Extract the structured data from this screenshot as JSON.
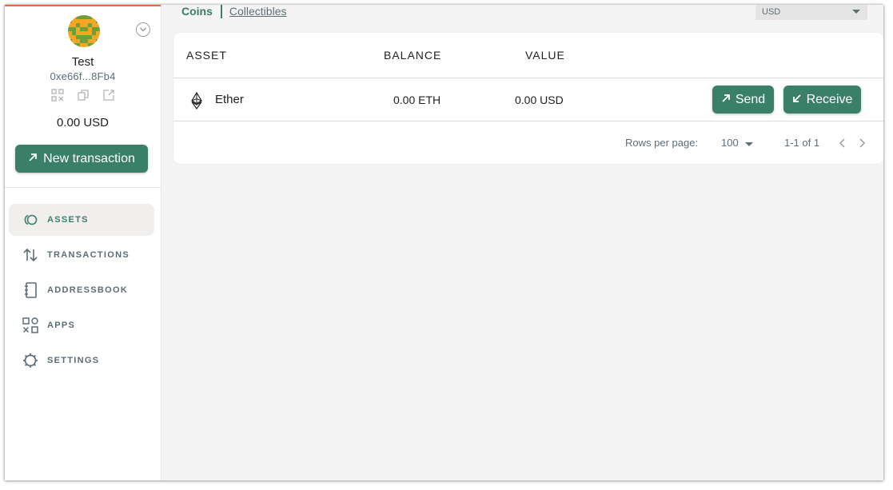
{
  "safe": {
    "name": "Test",
    "address": "0xe66f...8Fb4",
    "balance": "0.00 USD",
    "new_transaction_label": "New transaction"
  },
  "nav": {
    "items": [
      {
        "label": "ASSETS",
        "icon": "assets-icon",
        "active": true
      },
      {
        "label": "TRANSACTIONS",
        "icon": "transactions-icon",
        "active": false
      },
      {
        "label": "ADDRESSBOOK",
        "icon": "addressbook-icon",
        "active": false
      },
      {
        "label": "APPS",
        "icon": "apps-icon",
        "active": false
      },
      {
        "label": "SETTINGS",
        "icon": "settings-icon",
        "active": false
      }
    ]
  },
  "tabs": {
    "coins": "Coins",
    "collectibles": "Collectibles"
  },
  "currency": {
    "selected": "USD"
  },
  "table": {
    "headers": {
      "asset": "ASSET",
      "balance": "BALANCE",
      "value": "VALUE"
    },
    "rows": [
      {
        "asset": "Ether",
        "balance": "0.00 ETH",
        "value": "0.00 USD",
        "send_label": "Send",
        "receive_label": "Receive"
      }
    ]
  },
  "pagination": {
    "rows_per_page_label": "Rows per page:",
    "rows_per_page": "100",
    "range": "1-1 of 1"
  },
  "colors": {
    "accent": "#3a8069",
    "top_line": "#e8673c",
    "muted_text": "#5d6d74",
    "background": "#f4f4f4"
  }
}
